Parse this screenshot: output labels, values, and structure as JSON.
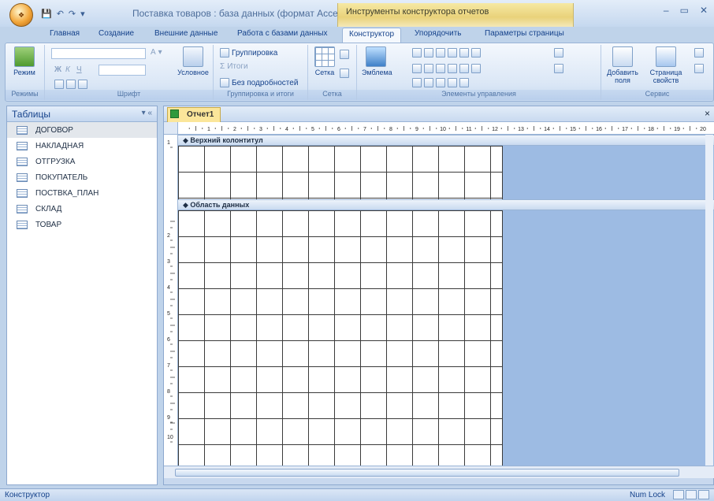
{
  "window": {
    "doc_title": "Поставка товаров : база данных (формат Acces...",
    "context_title": "Инструменты конструктора отчетов",
    "minimize": "–",
    "maximize": "▭",
    "close": "✕"
  },
  "tabs": [
    "Главная",
    "Создание",
    "Внешние данные",
    "Работа с базами данных",
    "Конструктор",
    "Упорядочить",
    "Параметры страницы"
  ],
  "ribbon": {
    "groups": {
      "modes": "Режимы",
      "font": "Шрифт",
      "grouping": "Группировка и итоги",
      "grid": "Сетка",
      "controls": "Элементы управления",
      "service": "Сервис"
    },
    "mode_button": "Режим",
    "conditional": "Условное",
    "group_btn": "Группировка",
    "totals_btn": "Итоги",
    "no_details_btn": "Без подробностей",
    "grid_btn": "Сетка",
    "logo_btn": "Эмблема",
    "add_fields": "Добавить поля",
    "property_sheet": "Страница свойств",
    "bold": "Ж",
    "italic": "К",
    "underline": "Ч",
    "font_a": "A"
  },
  "nav": {
    "title": "Таблицы",
    "controls": "▾ «",
    "items": [
      "ДОГОВОР",
      "НАКЛАДНАЯ",
      "ОТГРУЗКА",
      "ПОКУПАТЕЛЬ",
      "ПОСТВКА_ПЛАН",
      "СКЛАД",
      "ТОВАР"
    ]
  },
  "document": {
    "tab_label": "Отчет1",
    "close": "×",
    "sections": {
      "header": "Верхний колонтитул",
      "detail": "Область данных"
    },
    "hruler": [
      "1",
      "2",
      "3",
      "4",
      "5",
      "6",
      "7",
      "8",
      "9",
      "10",
      "11",
      "12",
      "13",
      "14",
      "15",
      "16",
      "17",
      "18",
      "19",
      "20"
    ],
    "vruler": [
      "1",
      "2",
      "3",
      "4",
      "5",
      "6",
      "7",
      "8",
      "9",
      "10"
    ]
  },
  "status": {
    "mode": "Конструктор",
    "numlock": "Num Lock"
  }
}
